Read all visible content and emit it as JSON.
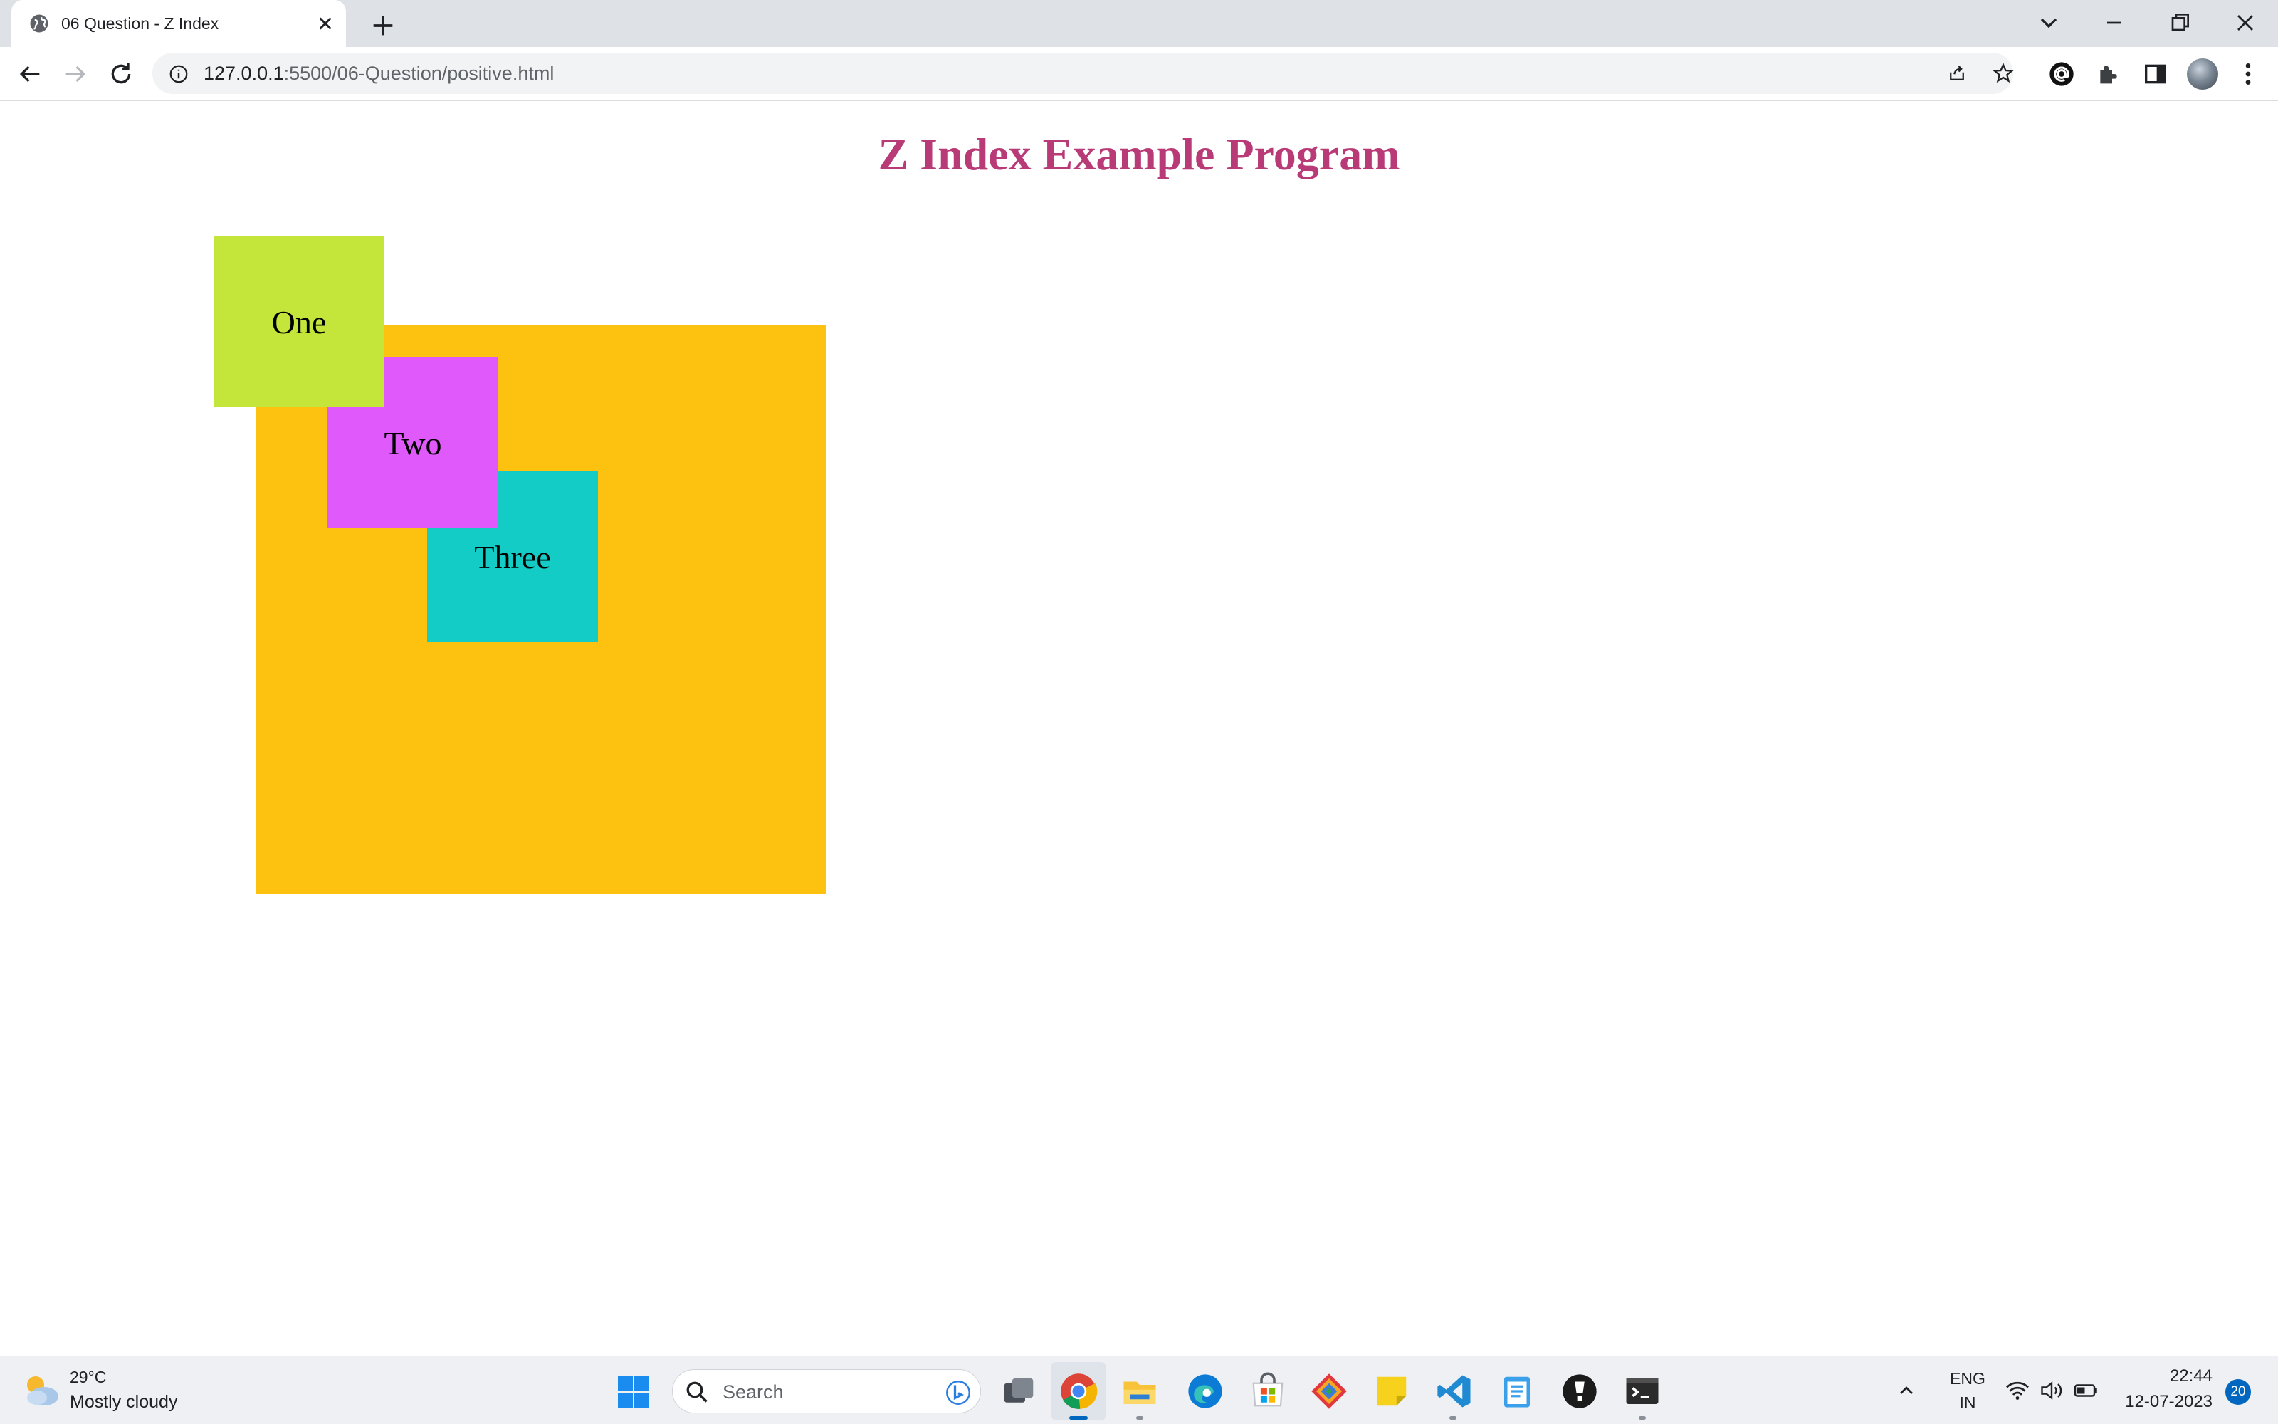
{
  "browser": {
    "tab": {
      "title": "06 Question - Z Index"
    },
    "address": {
      "host": "127.0.0.1",
      "path": ":5500/06-Question/positive.html"
    }
  },
  "page": {
    "heading": "Z Index Example Program",
    "boxes": [
      {
        "label": "One",
        "color": "#c4e539"
      },
      {
        "label": "Two",
        "color": "#e059fb"
      },
      {
        "label": "Three",
        "color": "#14ccc6"
      },
      {
        "label": "",
        "color": "#fdc210"
      }
    ],
    "heading_color": "#b83a76"
  },
  "taskbar": {
    "weather": {
      "temp": "29°C",
      "condition": "Mostly cloudy"
    },
    "search": {
      "placeholder": "Search"
    },
    "apps": [
      "task-view",
      "chrome",
      "file-explorer",
      "edge",
      "microsoft-store",
      "git-client",
      "sticky-notes",
      "vs-code",
      "notepad",
      "terminal-app",
      "windows-terminal"
    ],
    "tray": {
      "language": "ENG",
      "region": "IN",
      "time": "22:44",
      "date": "12-07-2023",
      "notifications": "20"
    }
  }
}
